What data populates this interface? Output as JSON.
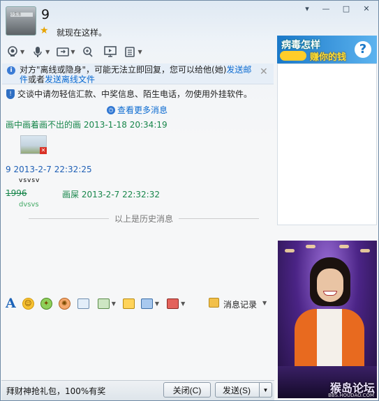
{
  "window": {
    "controls": [
      "▾",
      "—",
      "□",
      "✕"
    ]
  },
  "contact": {
    "name": "9",
    "signature": "就现在这样。",
    "avatar_caption": "小生活"
  },
  "ads": {
    "top_line1": "病毒怎样",
    "top_line2": "赚你的钱",
    "top_q": "?",
    "watermark": "猴岛论坛",
    "watermark_url": "BBS.HOUDAO.COM"
  },
  "chat": {
    "offline_notice_prefix": "对方\"离线或隐身\"，可能无法立即回复，您可以给他(她)",
    "offline_link1": "发送邮件",
    "offline_mid": "或者",
    "offline_link2": "发送离线文件",
    "security_warning": "交谈中请勿轻信汇款、中奖信息、陌生电话，勿使用外挂软件。",
    "view_more": "查看更多消息",
    "messages": [
      {
        "header": "画中画着画不出的画  2013-1-18 20:34:19",
        "body": ""
      },
      {
        "header": "9  2013-2-7 22:32:25",
        "body": "vsvsv"
      },
      {
        "sender": "1996",
        "header": "画屎  2013-2-7 22:32:32",
        "body": "dvsvs"
      }
    ],
    "history_marker": "以上是历史消息"
  },
  "input_toolbar": {
    "font_glyph": "A",
    "message_record": "消息记录"
  },
  "footer": {
    "promo": "拜财神抢礼包，100%有奖",
    "close_label": "关闭(C)",
    "send_label": "发送(S)"
  }
}
